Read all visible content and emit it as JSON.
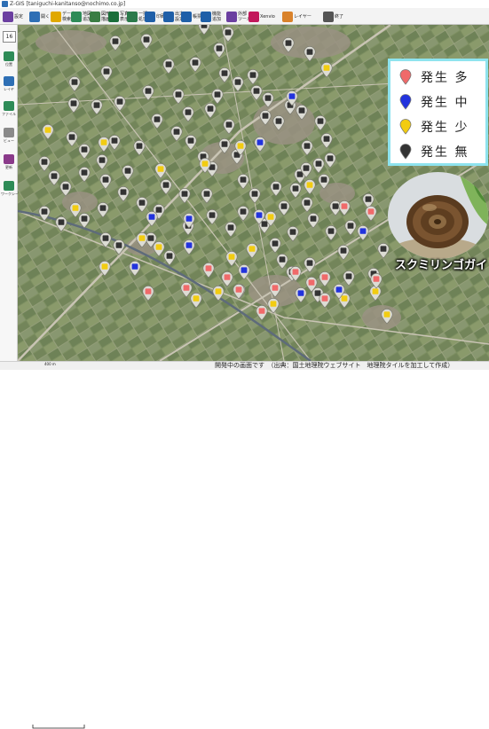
{
  "window": {
    "title": "Z-GIS [taniguchi-kanitanso@nochimo.co.jp]"
  },
  "toolbar": {
    "buttons": [
      {
        "label": "設定",
        "icon": "gear-icon",
        "color": "#6b3fa0"
      },
      {
        "label": "開く",
        "icon": "folder-icon",
        "color": "#2e6fb5"
      },
      {
        "label": "データ\n検索",
        "icon": "search-icon",
        "color": "#e0a800"
      },
      {
        "label": "地図\n追加",
        "icon": "map-add-icon",
        "color": "#2e8b57"
      },
      {
        "label": "図形\n描画",
        "icon": "draw-icon",
        "color": "#3a7d44"
      },
      {
        "label": "写真\n表示",
        "icon": "photo-icon",
        "color": "#1b6e3a"
      },
      {
        "label": "一括\n処理",
        "icon": "grid-icon",
        "color": "#2b7a4b"
      },
      {
        "label": "印刷",
        "icon": "print-icon",
        "color": "#1f5fa8"
      },
      {
        "label": "出力\n設定",
        "icon": "export-icon",
        "color": "#1f5fa8"
      },
      {
        "label": "帳票",
        "icon": "report-icon",
        "color": "#1f5fa8"
      },
      {
        "label": "機能\n追加",
        "icon": "plugin-icon",
        "color": "#1f5fa8"
      },
      {
        "label": "外部\nツール",
        "icon": "tools-icon",
        "color": "#6b3fa0"
      },
      {
        "label": "Xenvio",
        "icon": "xenvio-icon",
        "color": "#c2185b"
      },
      {
        "label": "レイヤー",
        "icon": "layer-person-icon",
        "color": "#d9822b"
      },
      {
        "label": "終了",
        "icon": "exit-icon",
        "color": "#555555"
      }
    ]
  },
  "sidebar": {
    "zoom_level": "16",
    "items": [
      {
        "label": "位置",
        "icon": "location-icon",
        "color": "#2e8b57"
      },
      {
        "label": "レイヤ",
        "icon": "layer-icon",
        "color": "#2e6fb5"
      },
      {
        "label": "ファイル",
        "icon": "file-icon",
        "color": "#2e8b57"
      },
      {
        "label": "ビュー",
        "icon": "eye-icon",
        "color": "#8a8a8a"
      },
      {
        "label": "更新",
        "icon": "update-icon",
        "color": "#8a3a8a"
      },
      {
        "label": "ワークシート(A)",
        "icon": "worksheet-icon",
        "color": "#2e8b57"
      }
    ]
  },
  "legend": {
    "title": "",
    "items": [
      {
        "label": "発生 多",
        "color": "#f06a6a"
      },
      {
        "label": "発生 中",
        "color": "#2233dd"
      },
      {
        "label": "発生 少",
        "color": "#f2cc11"
      },
      {
        "label": "発生 無",
        "color": "#333333"
      }
    ]
  },
  "overlay": {
    "caption": "スクミリンゴガイ",
    "photo_subject": "apple-snail"
  },
  "status": {
    "scale_text": "400 m",
    "message": "開発中の画面です　（出典：国土地理院ウェブサイト　地理院タイルを加工して作成）"
  },
  "markers": {
    "levels": [
      "none",
      "low",
      "mid",
      "high"
    ],
    "none_count": 95,
    "low_count": 21,
    "mid_count": 11,
    "high_count": 14
  }
}
